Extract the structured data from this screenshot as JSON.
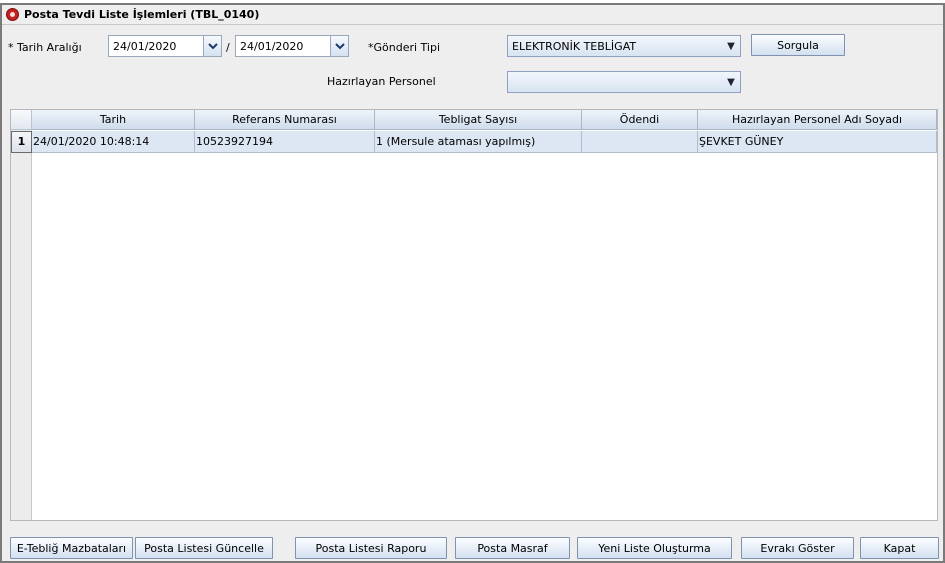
{
  "window": {
    "title": "Posta Tevdi Liste İşlemleri (TBL_0140)"
  },
  "filters": {
    "date_range_label": "* Tarih Aralığı",
    "date_from": "24/01/2020",
    "date_separator": "/",
    "date_to": "24/01/2020",
    "send_type_label": "*Gönderi Tipi",
    "send_type_value": "ELEKTRONİK TEBLİGAT",
    "query_button": "Sorgula",
    "staff_label": "Hazırlayan Personel",
    "staff_value": ""
  },
  "table": {
    "columns": [
      "Tarih",
      "Referans Numarası",
      "Tebligat Sayısı",
      "Ödendi",
      "Hazırlayan Personel Adı Soyadı"
    ],
    "rows": [
      {
        "num": "1",
        "tarih": "24/01/2020 10:48:14",
        "referans": "10523927194",
        "tebligat": "1 (Mersule ataması yapılmış)",
        "odendi": "",
        "personel": "ŞEVKET GÜNEY"
      }
    ]
  },
  "footer": {
    "buttons": [
      "E-Tebliğ Mazbataları",
      "Posta Listesi Güncelle",
      "Posta Listesi Raporu",
      "Posta Masraf",
      "Yeni Liste Oluşturma",
      "Evrakı Göster",
      "Kapat"
    ]
  },
  "colors": {
    "window_bg": "#eeeeee",
    "header_bg": "#cfdcec",
    "selected_row_bg": "#dde6f3",
    "title_icon": "#c42020"
  },
  "icons": [
    "app-seal-icon",
    "chevron-down-icon"
  ]
}
